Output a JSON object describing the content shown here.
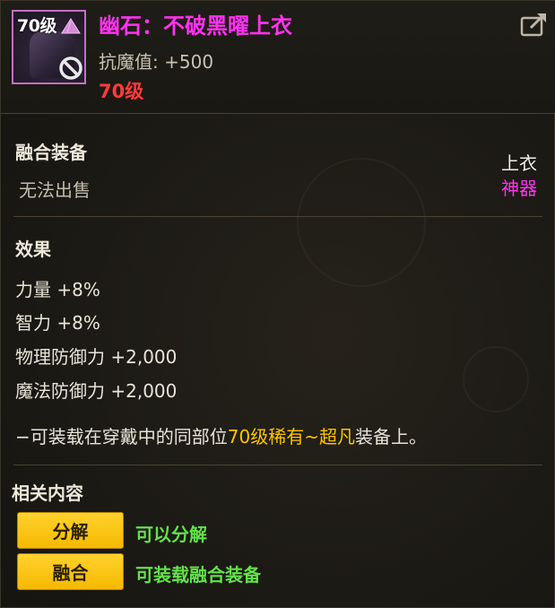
{
  "header": {
    "icon_level": "70级",
    "item_name": "幽石：不破黑曜上衣",
    "stat_label": "抗魔值:",
    "stat_value": "+500",
    "level_requirement": "70级"
  },
  "info": {
    "category": "融合装备",
    "trade_status": "无法出售",
    "slot": "上衣",
    "grade": "神器"
  },
  "effects": {
    "title": "效果",
    "lines": [
      "力量 +8%",
      "智力 +8%",
      "物理防御力 +2,000",
      "魔法防御力 +2,000"
    ],
    "note_prefix": "−可装载在穿戴中的同部位",
    "note_highlight": "70级稀有~超凡",
    "note_suffix": "装备上。"
  },
  "related": {
    "title": "相关内容",
    "actions": [
      {
        "label": "分解",
        "desc": "可以分解"
      },
      {
        "label": "融合",
        "desc": "可装载融合装备"
      }
    ]
  },
  "colors": {
    "item_name": "#ff33ee",
    "level_requirement": "#ff3b3b",
    "grade": "#ff33ee",
    "highlight": "#ffc400",
    "action_button": "#ffcc1a",
    "action_desc": "#62e24a"
  }
}
